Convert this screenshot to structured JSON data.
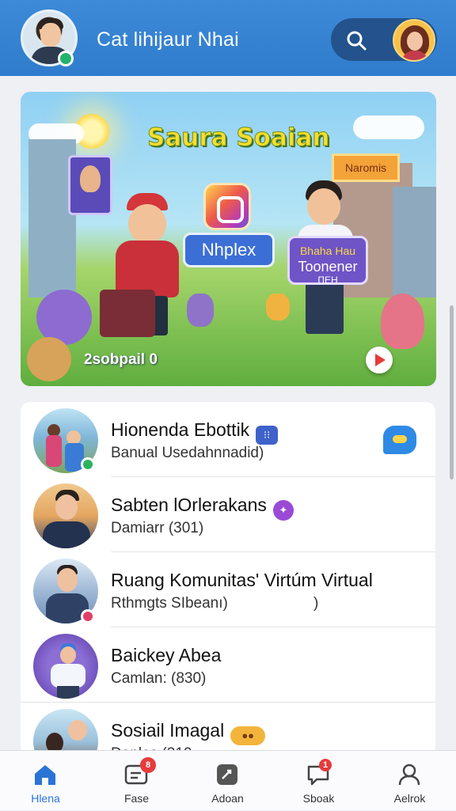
{
  "header": {
    "title": "Cat lihijaur Nhai",
    "avatar": "user-avatar",
    "search_icon": "search-icon",
    "profile_avatar": "profile-avatar"
  },
  "banner": {
    "title": "Saura Soaian",
    "bubble_left": "Nhplex",
    "bubble_right_top": "Bhaha Hau",
    "bubble_right_mid": "Toonener",
    "bubble_right_bottom": "ПЕН",
    "sign": "Naromis",
    "stats": "2sobpail 0",
    "play_icon": "play-icon"
  },
  "communities": [
    {
      "name": "Hionenda Ebottik",
      "sub": "Banual Usedahnnadid)",
      "badge_color": "#3e62c9",
      "badge": "⁝⁝",
      "action_icon": "chat-bubble-icon"
    },
    {
      "name": "Sabten lOrlerakans",
      "sub": "Damiarr (301)",
      "badge_color": "#9a4ad6",
      "badge": "✦"
    },
    {
      "name": "Ruang Komunitas' Virtúm Virtual",
      "sub": "Rthmgts SIbeanı)",
      "sub_suffix": ")"
    },
    {
      "name": "Baickey Abea",
      "sub": "Camlan: (830)"
    },
    {
      "name": "Sosiail Imagal",
      "sub": "Danlos (310",
      "badge_color": "#f2b43b",
      "badge": "●●"
    }
  ],
  "tabs": [
    {
      "label": "Hlena",
      "icon": "home-icon",
      "active": true
    },
    {
      "label": "Fase",
      "icon": "feed-icon",
      "badge": "8"
    },
    {
      "label": "Adoan",
      "icon": "create-icon"
    },
    {
      "label": "Sboak",
      "icon": "chat-icon",
      "badge": "1"
    },
    {
      "label": "Aelrok",
      "icon": "profile-icon"
    }
  ],
  "colors": {
    "header": "#3583d2",
    "accent": "#2a74d6",
    "notification": "#e63b3b"
  }
}
